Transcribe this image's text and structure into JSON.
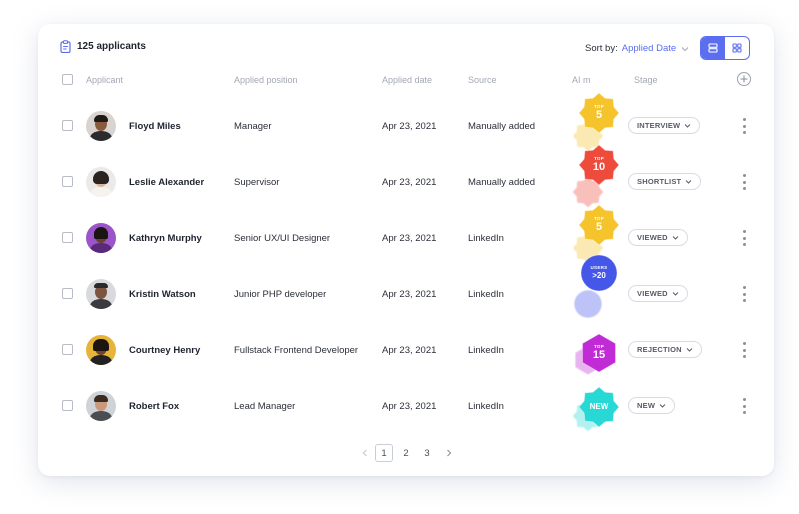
{
  "header": {
    "applicant_count": "125 applicants",
    "sort_label": "Sort by:",
    "sort_value": "Applied Date"
  },
  "columns": {
    "applicant": "Applicant",
    "position": "Applied position",
    "date": "Applied date",
    "source": "Source",
    "ai": "AI m",
    "stage": "Stage"
  },
  "rows": [
    {
      "name": "Floyd Miles",
      "position": "Manager",
      "date": "Apr 23, 2021",
      "source": "Manually added",
      "stage": "INTERVIEW",
      "badge": {
        "top": "TOP",
        "value": "5",
        "color": "#f5c32c",
        "shape": "star"
      }
    },
    {
      "name": "Leslie Alexander",
      "position": "Supervisor",
      "date": "Apr 23, 2021",
      "source": "Manually added",
      "stage": "SHORTLIST",
      "badge": {
        "top": "TOP",
        "value": "10",
        "color": "#ef4b3c",
        "shape": "star"
      }
    },
    {
      "name": "Kathryn Murphy",
      "position": "Senior UX/UI Designer",
      "date": "Apr 23, 2021",
      "source": "LinkedIn",
      "stage": "VIEWED",
      "badge": {
        "top": "TOP",
        "value": "5",
        "color": "#f5c32c",
        "shape": "star"
      }
    },
    {
      "name": "Kristin Watson",
      "position": "Junior PHP developer",
      "date": "Apr 23, 2021",
      "source": "LinkedIn",
      "stage": "VIEWED",
      "badge": {
        "top": "USERS",
        "value": ">20",
        "color": "#4557e8",
        "shape": "circle"
      }
    },
    {
      "name": "Courtney Henry",
      "position": "Fullstack Frontend Developer",
      "date": "Apr 23, 2021",
      "source": "LinkedIn",
      "stage": "REJECTION",
      "badge": {
        "top": "TOP",
        "value": "15",
        "color": "#c02bd6",
        "shape": "hex"
      }
    },
    {
      "name": "Robert Fox",
      "position": "Lead Manager",
      "date": "Apr 23, 2021",
      "source": "LinkedIn",
      "stage": "NEW",
      "badge": {
        "top": "",
        "value": "NEW",
        "color": "#28d8d5",
        "shape": "star"
      }
    }
  ],
  "pagination": {
    "pages": [
      "1",
      "2",
      "3"
    ],
    "current": "1"
  },
  "colors": {
    "accent": "#5b6ef0",
    "muted": "#a3a8b5"
  },
  "icons": {
    "list_view": "list-view-icon",
    "grid_view": "grid-view-icon",
    "add_column": "plus-circle-icon",
    "more": "kebab-icon"
  }
}
